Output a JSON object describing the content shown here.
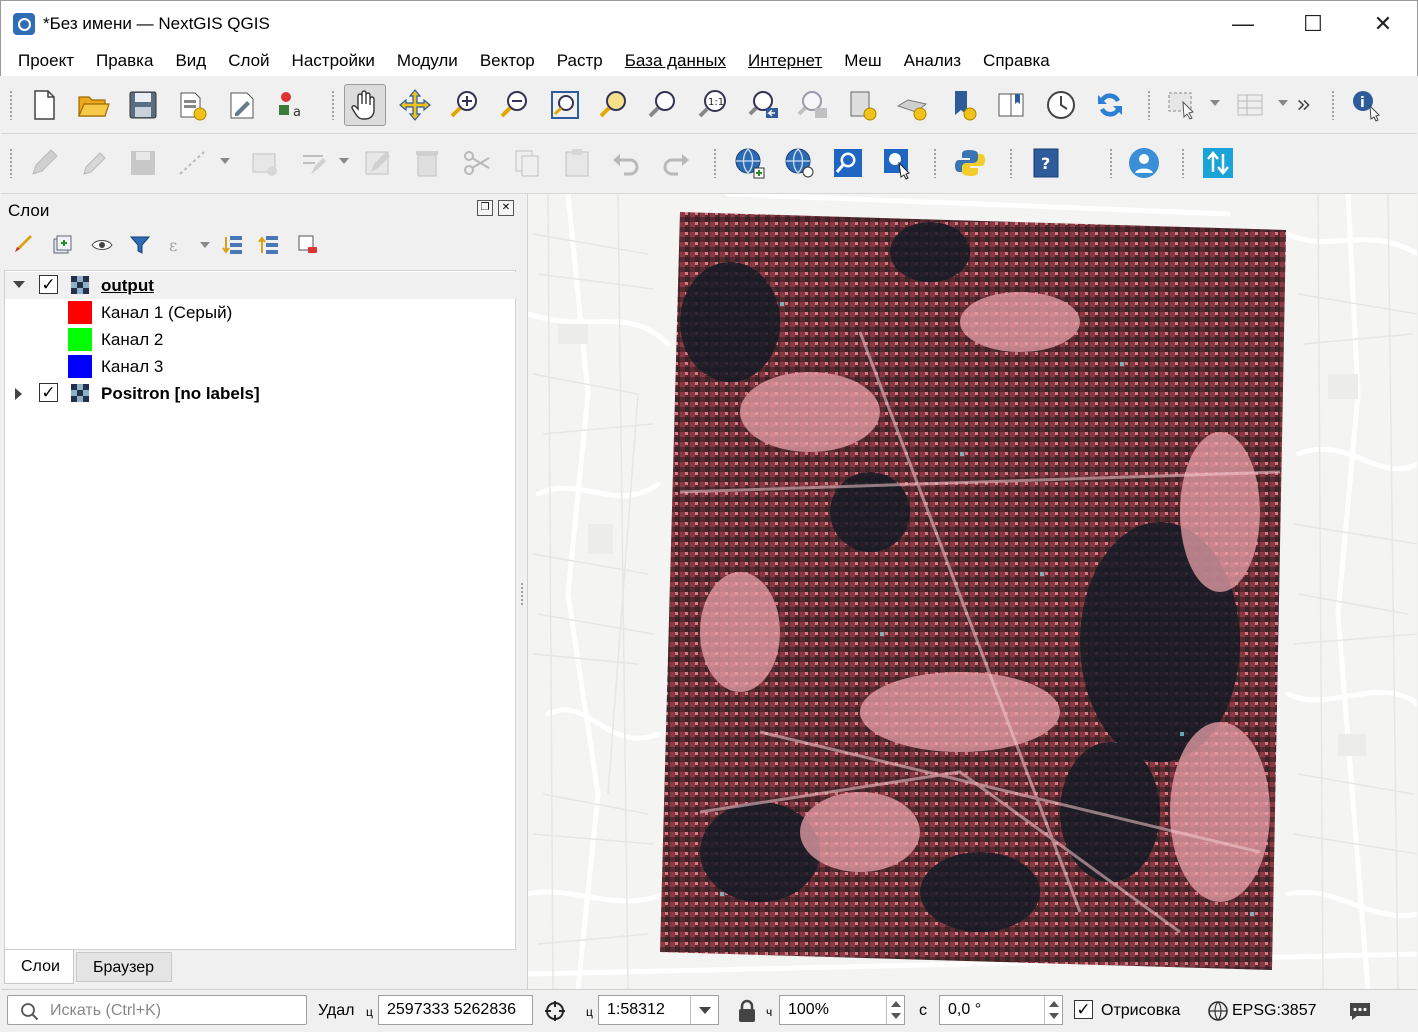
{
  "window": {
    "title": "*Без имени — NextGIS QGIS",
    "minimize": "—",
    "maximize": "☐",
    "close": "✕"
  },
  "menu": [
    "Проект",
    "Правка",
    "Вид",
    "Слой",
    "Настройки",
    "Модули",
    "Вектор",
    "Растр",
    "База данных",
    "Интернет",
    "Меш",
    "Анализ",
    "Справка"
  ],
  "layers_panel": {
    "title": "Слои",
    "tree": [
      {
        "name": "output",
        "checked": "✓",
        "expanded": true,
        "bands": [
          {
            "label": "Канал 1 (Серый)",
            "color": "#ff0000"
          },
          {
            "label": "Канал 2",
            "color": "#00ff00"
          },
          {
            "label": "Канал 3",
            "color": "#0000ff"
          }
        ]
      },
      {
        "name": "Positron [no labels]",
        "checked": "✓",
        "expanded": false
      }
    ],
    "tabs": [
      "Слои",
      "Браузер"
    ]
  },
  "statusbar": {
    "search_placeholder": "Искать (Ctrl+K)",
    "coord_label": "Удал",
    "coord_icon_label": "ц",
    "coordinates": "2597333  5262836",
    "scale_prefix": "ц",
    "scale": "1:58312",
    "magnifier": "100%",
    "magnifier_label": "ч",
    "rotation_label": "с",
    "rotation": "0,0 °",
    "render_checked": "✓",
    "render_label": "Отрисовка",
    "crs": "EPSG:3857"
  },
  "colors": {
    "accent": "#2f6db4",
    "map_background": "#f4f4f2",
    "raster_tint": "#c83c46"
  }
}
